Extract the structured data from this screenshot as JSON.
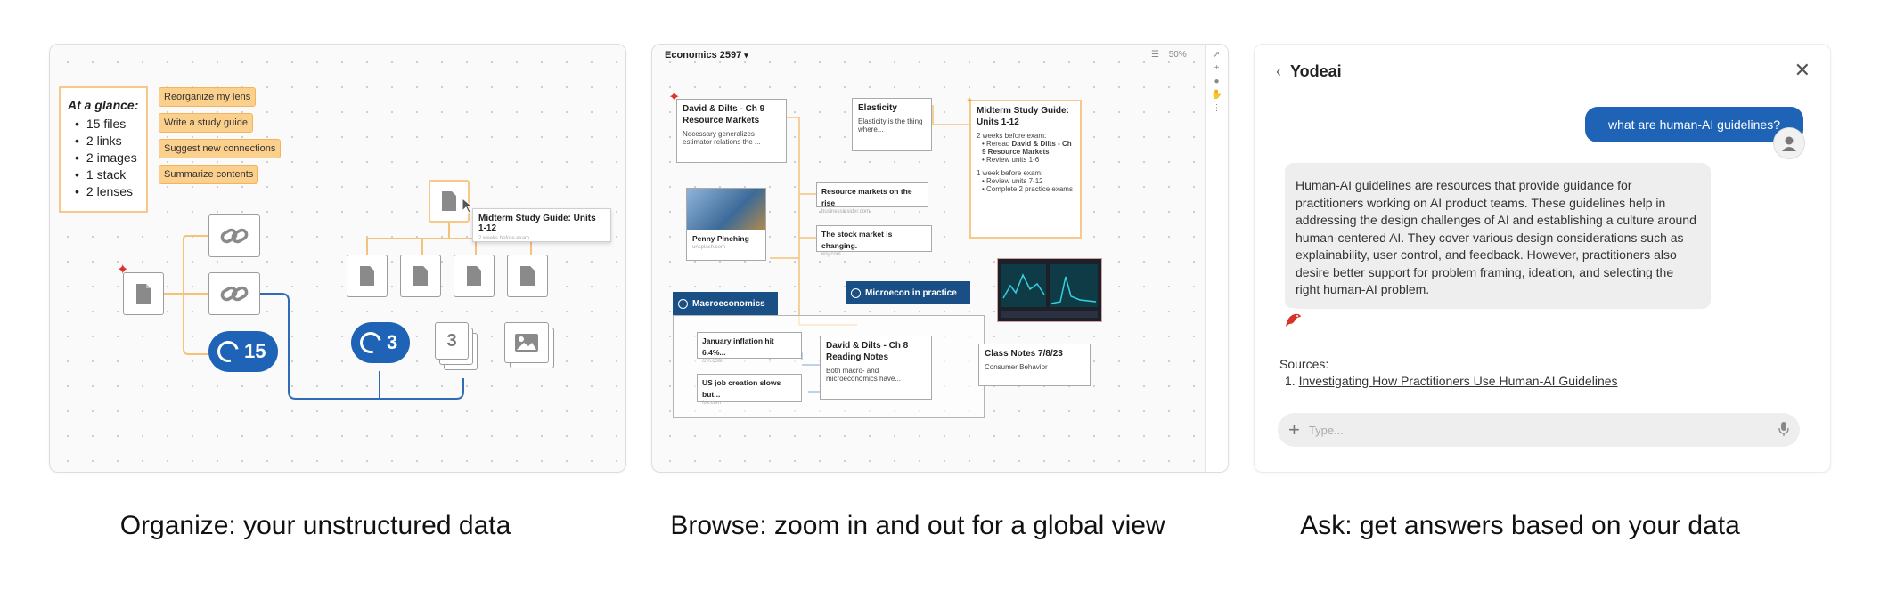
{
  "panel1": {
    "glance_title": "At a glance:",
    "glance_items": [
      "15 files",
      "2 links",
      "2 images",
      "1 stack",
      "2 lenses"
    ],
    "suggestions": [
      "Reorganize my lens",
      "Write a study guide",
      "Suggest new connections",
      "Summarize contents"
    ],
    "lens_count_a": "15",
    "lens_count_b": "3",
    "stack_count": "3",
    "tooltip_title": "Midterm Study Guide: Units 1-12",
    "tooltip_sub": "2 weeks before exam..."
  },
  "panel2": {
    "workspace": "Economics 2597",
    "zoom": "50%",
    "cards": {
      "dilts_title": "David & Dilts - Ch 9 Resource Markets",
      "dilts_body": "Necessary generalizes estimator relations the ...",
      "elasticity_title": "Elasticity",
      "elasticity_body": "Elasticity is the thing where...",
      "penny_title": "Penny Pinching",
      "penny_src": "unsplash.com",
      "resource_title": "Resource markets on the rise",
      "resource_src": "businessinsider.com",
      "stock_title": "The stock market is changing.",
      "stock_src": "wsj.com",
      "guide_title": "Midterm Study Guide: Units 1-12",
      "guide_l1": "2 weeks before exam:",
      "guide_l2a": "Reread ",
      "guide_l2b": "David & Dilts - Ch 9 Resource Markets",
      "guide_l3": "Review units 1-6",
      "guide_l4": "1 week before exam:",
      "guide_l5": "Review units 7-12",
      "guide_l6": "Complete 2 practice exams",
      "inflation_title": "January inflation hit 6.4%...",
      "inflation_src": "cnn.com",
      "jobs_title": "US job creation slows but...",
      "jobs_src": "fox.com",
      "reading_title": "David & Dilts - Ch 8 Reading Notes",
      "reading_body": "Both macro- and microeconomics have...",
      "classnotes_title": "Class Notes 7/8/23",
      "classnotes_body": "Consumer Behavior"
    },
    "lens_macro": "Macroeconomics",
    "lens_micro": "Microecon in practice"
  },
  "panel3": {
    "title": "Yodeai",
    "question": "what are human-AI guidelines?",
    "answer": "Human-AI guidelines are resources that provide guidance for practitioners working on AI product teams. These guidelines help in addressing the design challenges of AI and establishing a culture around human-centered AI. They cover various design considerations such as explainability, user control, and feedback. However, practitioners also desire better support for problem framing, ideation, and selecting the right human-AI problem.",
    "sources_label": "Sources:",
    "source_num": "1.",
    "source_1": "Investigating How Practitioners Use Human-AI Guidelines",
    "input_placeholder": "Type..."
  },
  "captions": [
    "Organize: your unstructured data",
    "Browse: zoom in and out for a global view",
    "Ask: get answers based on your data"
  ],
  "colors": {
    "accent_blue": "#1f63b6",
    "lens_navy": "#1a4f86",
    "suggest_orange": "#fbd08d",
    "highlight_border": "#f6c98a"
  }
}
